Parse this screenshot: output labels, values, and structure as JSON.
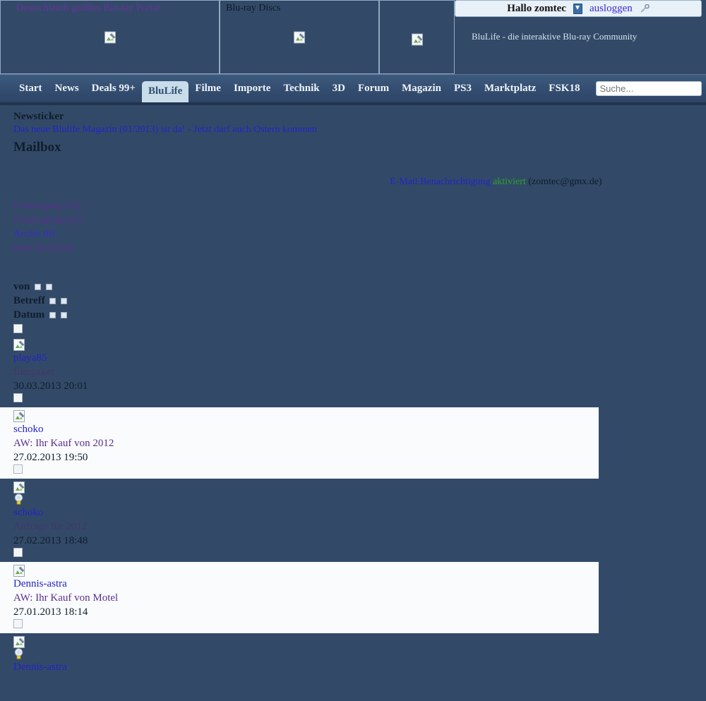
{
  "banner": {
    "cells": [
      {
        "label": "Deutschlands größtes Blu-ray Portal",
        "kind": "link",
        "icon": "broken-image-icon"
      },
      {
        "label": "Blu-ray Discs",
        "kind": "text",
        "icon": "broken-image-icon"
      },
      {
        "label": "",
        "kind": "text",
        "icon": "broken-image-icon"
      }
    ]
  },
  "userbar": {
    "greeting": "Hallo zomtec",
    "download_icon": "download-icon",
    "logout_label": "ausloggen",
    "key_icon": "key-icon",
    "tagline": "BluLife - die interaktive Blu-ray Community"
  },
  "nav": {
    "items": [
      {
        "label": "Start",
        "active": false
      },
      {
        "label": "News",
        "active": false
      },
      {
        "label": "Deals 99+",
        "active": false
      },
      {
        "label": "BluLife",
        "active": true
      },
      {
        "label": "Filme",
        "active": false
      },
      {
        "label": "Importe",
        "active": false
      },
      {
        "label": "Technik",
        "active": false
      },
      {
        "label": "3D",
        "active": false
      },
      {
        "label": "Forum",
        "active": false
      },
      {
        "label": "Magazin",
        "active": false
      },
      {
        "label": "PS3",
        "active": false
      },
      {
        "label": "Marktplatz",
        "active": false
      },
      {
        "label": "FSK18",
        "active": false
      }
    ],
    "search_placeholder": "Suche...",
    "search_value": "",
    "search_button_icon": "broken-image-icon"
  },
  "newsticker": {
    "title": "Newsticker",
    "headline": "Das neue Blulife Magazin (01/2013) ist da! - Jetzt darf auch Ostern kommen"
  },
  "mailbox": {
    "title": "Mailbox",
    "notification": {
      "link_label": "E-Mail Benachrichtigung",
      "status": "aktiviert",
      "address": "(zomtec@gmx.de)"
    },
    "folders": [
      {
        "label": "Posteingang (10)",
        "visited": true
      },
      {
        "label": "Postausgang (30)",
        "visited": true
      },
      {
        "label": "Archiv (0)",
        "visited": false
      },
      {
        "label": "neue Nachricht",
        "visited": true
      }
    ],
    "columns": [
      {
        "label": "von"
      },
      {
        "label": "Betreff"
      },
      {
        "label": "Datum"
      }
    ],
    "messages": [
      {
        "from": "playa85",
        "from_visited": false,
        "subject": "filmpaket",
        "subject_faint": true,
        "date": "30.03.2013 20:01",
        "highlighted": false,
        "has_medal": false,
        "icon": "broken-image-icon"
      },
      {
        "from": "schoko",
        "from_visited": false,
        "subject": "AW: Ihr Kauf von 2012",
        "subject_faint": false,
        "date": "27.02.2013 19:50",
        "highlighted": true,
        "has_medal": false,
        "icon": "broken-image-icon"
      },
      {
        "from": "schoko",
        "from_visited": false,
        "subject": "Anfrage für 2012",
        "subject_faint": true,
        "date": "27.02.2013 18:48",
        "highlighted": false,
        "has_medal": true,
        "icon": "broken-image-icon"
      },
      {
        "from": "Dennis-astra",
        "from_visited": false,
        "subject": "AW: Ihr Kauf von Motel",
        "subject_faint": false,
        "date": "27.01.2013 18:14",
        "highlighted": true,
        "has_medal": false,
        "icon": "broken-image-icon"
      },
      {
        "from": "Dennis-astra",
        "from_visited": false,
        "subject": "",
        "subject_faint": false,
        "date": "",
        "highlighted": false,
        "has_medal": true,
        "icon": "broken-image-icon"
      }
    ]
  },
  "colors": {
    "page_background": "#324a68",
    "nav_active_tab": "#c9dcea",
    "link": "#2323c8",
    "visited_link": "#5b2f8f",
    "status_active": "#2ba22b",
    "row_highlight": "#f9fbfd"
  }
}
